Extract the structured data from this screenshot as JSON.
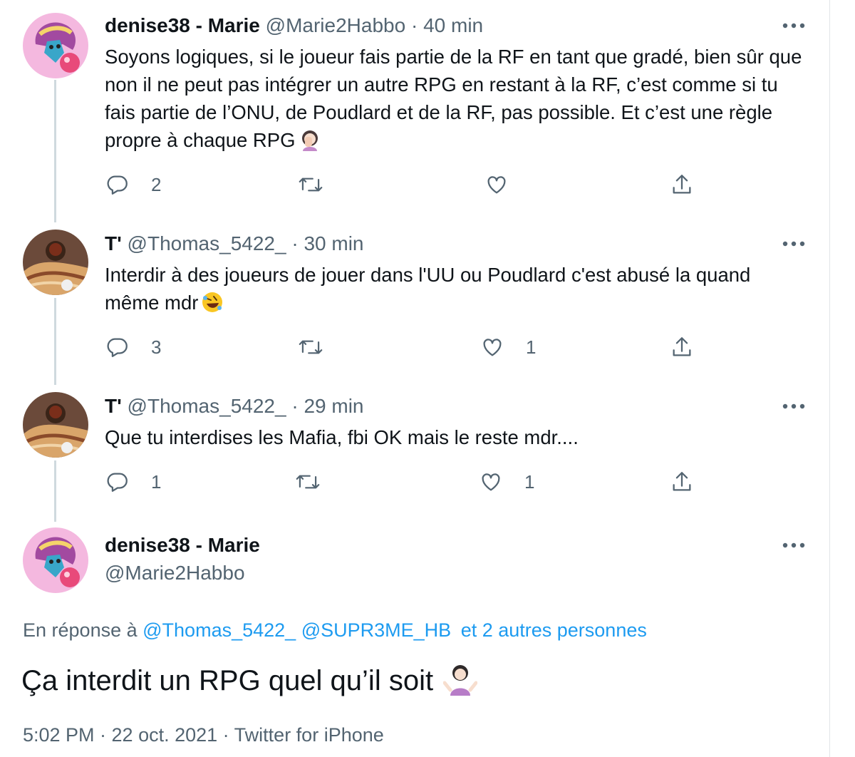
{
  "tweets": [
    {
      "display_name": "denise38 - Marie",
      "handle": "@Marie2Habbo",
      "separator": "·",
      "time": "40 min",
      "text": "Soyons logiques, si le joueur fais partie de la RF en tant que gradé, bien sûr que non il ne peut pas intégrer un autre RPG en restant à la RF, c’est comme si tu fais partie de l’ONU, de Poudlard et de la RF, pas possible. Et c’est une règle propre à chaque RPG",
      "emoji": "woman-facepalming-emoji",
      "reply_count": "2",
      "retweet_count": "",
      "like_count": ""
    },
    {
      "display_name": "T'",
      "handle": "@Thomas_5422_",
      "separator": "·",
      "time": "30 min",
      "text": "Interdir à des joueurs de jouer dans l'UU ou Poudlard c'est abusé la quand même mdr",
      "emoji": "rolling-on-floor-laughing-emoji",
      "reply_count": "3",
      "retweet_count": "",
      "like_count": "1"
    },
    {
      "display_name": "T'",
      "handle": "@Thomas_5422_",
      "separator": "·",
      "time": "29 min",
      "text": "Que tu interdises les Mafia, fbi OK mais le reste mdr....",
      "reply_count": "1",
      "retweet_count": "",
      "like_count": "1"
    }
  ],
  "main_tweet": {
    "display_name": "denise38 - Marie",
    "handle": "@Marie2Habbo",
    "reply_prefix": "En réponse à",
    "reply_mentions": [
      "@Thomas_5422_",
      "@SUPR3ME_HB",
      "et 2 autres personnes"
    ],
    "text": "Ça interdit un RPG quel qu’il soit",
    "emoji": "woman-shrugging-emoji",
    "timestamp": "5:02 PM · 22 oct. 2021 · Twitter for iPhone"
  },
  "colors": {
    "text": "#0f1419",
    "secondary": "#536471",
    "link": "#1d9bf0",
    "thread_line": "#cfd9de"
  },
  "icons": [
    "reply-icon",
    "retweet-icon",
    "like-icon",
    "share-icon",
    "more-icon"
  ]
}
